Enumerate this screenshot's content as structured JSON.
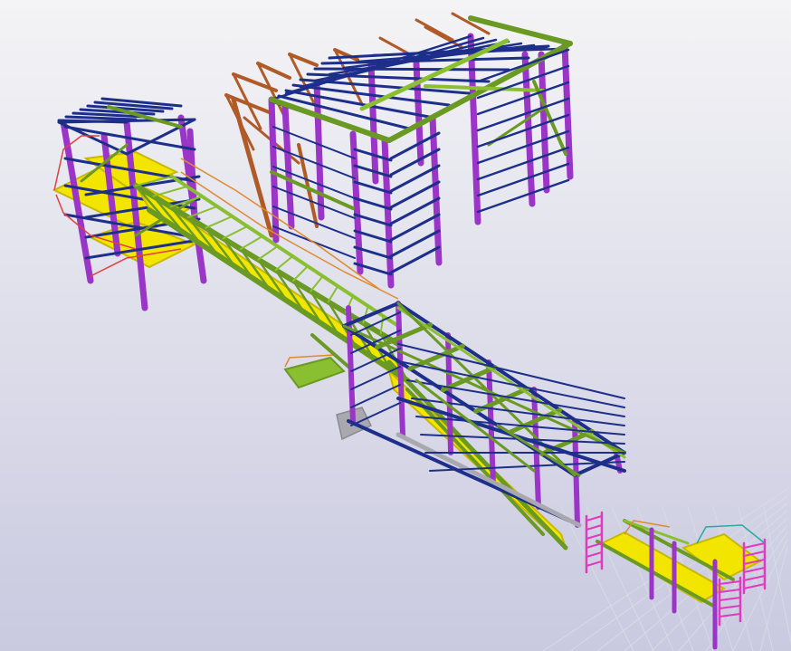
{
  "viewport": {
    "background_top": "#f4f4f6",
    "background_bottom": "#c9c9e0"
  },
  "colors": {
    "column": "#9b35c8",
    "beam": "#1d2f8a",
    "bracing": "#6a9a24",
    "bracing_light": "#8bbf32",
    "conveyor_deck": "#f2e600",
    "conveyor_edge": "#c9b800",
    "truss": "#b05a28",
    "railing_red": "#e04040",
    "railing_teal": "#2aa9a0",
    "railing_orange": "#e08a30",
    "ladder_magenta": "#e03ac0",
    "concrete": "#a8a8ae",
    "grid_line": "#dadae6"
  },
  "structures": [
    {
      "name": "tower"
    },
    {
      "name": "warehouse"
    },
    {
      "name": "inclined-conveyor"
    },
    {
      "name": "transfer-building"
    },
    {
      "name": "lower-platform"
    }
  ]
}
